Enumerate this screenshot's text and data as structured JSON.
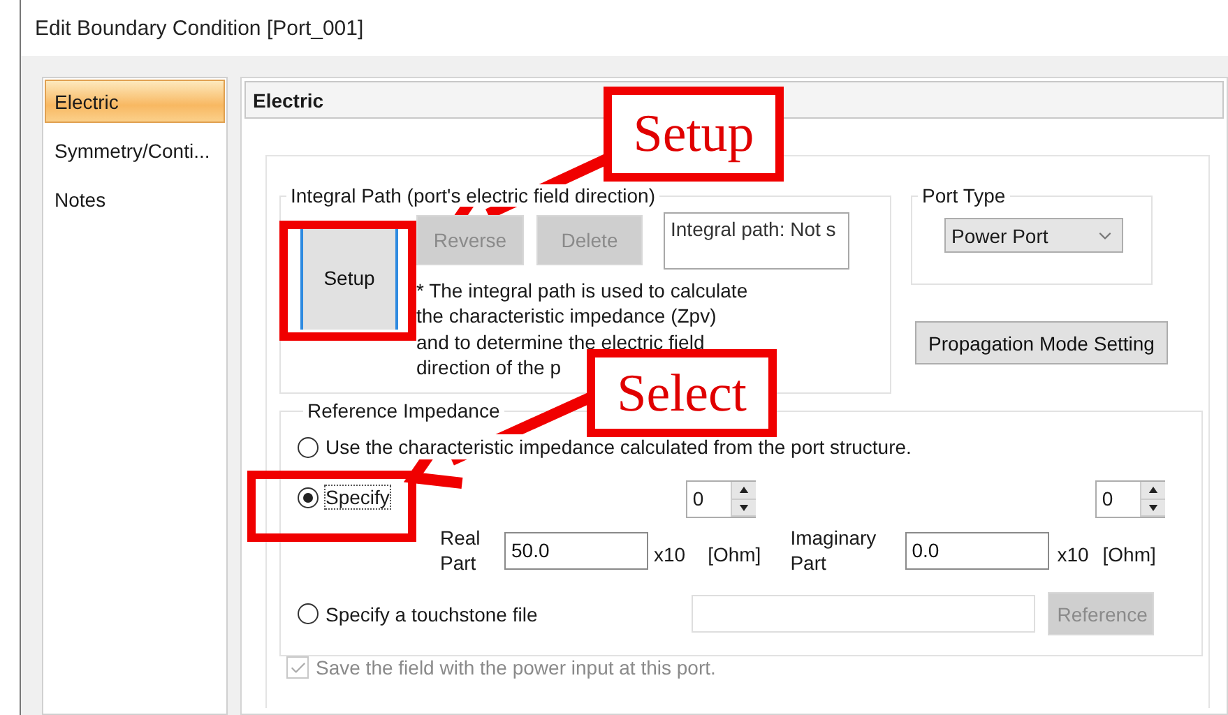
{
  "window": {
    "title": "Edit Boundary Condition [Port_001]"
  },
  "sidebar": {
    "items": [
      {
        "label": "Electric",
        "selected": true
      },
      {
        "label": "Symmetry/Conti...",
        "selected": false
      },
      {
        "label": "Notes",
        "selected": false
      }
    ]
  },
  "panel": {
    "title": "Electric"
  },
  "integral_path": {
    "title": "Integral Path (port's electric field direction)",
    "buttons": [
      {
        "label": "Setup",
        "disabled": false
      },
      {
        "label": "Reverse",
        "disabled": true
      },
      {
        "label": "Delete",
        "disabled": true
      }
    ],
    "status": "Integral path: Not s",
    "note_lines": [
      "* The integral path is used to calculate",
      "the characteristic impedance (Zpv)",
      "and to determine the electric field",
      "direction of the p"
    ]
  },
  "port_type": {
    "title": "Port Type",
    "value": "Power Port"
  },
  "propagation_button": {
    "label": "Propagation Mode Setting"
  },
  "reference_impedance": {
    "title": "Reference Impedance",
    "options": [
      {
        "label": "Use the characteristic impedance calculated from the port structure.",
        "selected": false
      },
      {
        "label": "Specify",
        "selected": true
      },
      {
        "label": "Specify a touchstone file",
        "selected": false
      }
    ],
    "parts": [
      {
        "label_lines": [
          "Real",
          "Part"
        ],
        "value": "50.0",
        "multiplier": "x10",
        "exponent": "0",
        "unit": "[Ohm]"
      },
      {
        "label_lines": [
          "Imaginary",
          "Part"
        ],
        "value": "0.0",
        "multiplier": "x10",
        "exponent": "0",
        "unit": "[Ohm]"
      }
    ],
    "reference_button": {
      "label": "Reference",
      "disabled": true
    }
  },
  "save_field": {
    "label": "Save the field with the power input at this port.",
    "checked": true,
    "disabled": true
  },
  "annotations": [
    {
      "text": "Setup"
    },
    {
      "text": "Select"
    }
  ]
}
